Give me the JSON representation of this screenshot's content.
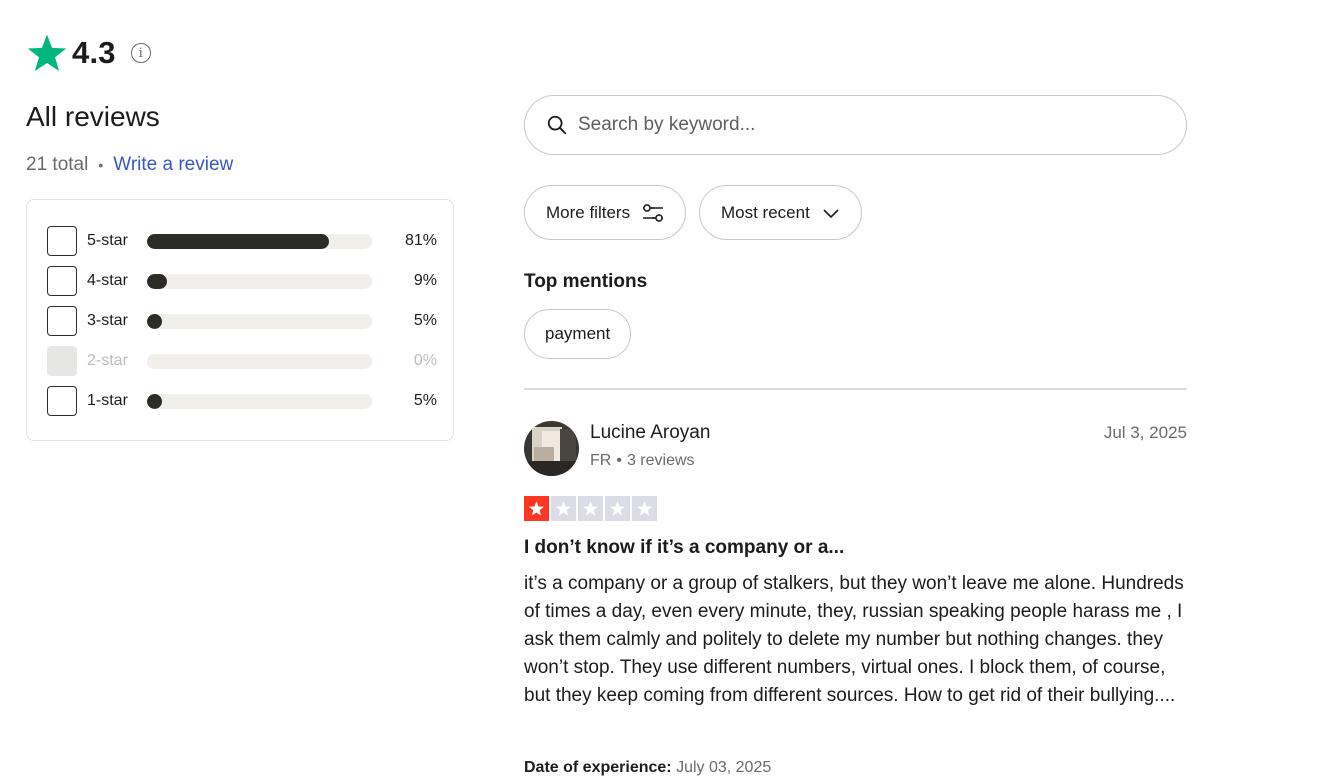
{
  "header": {
    "rating": "4.3",
    "info_icon": "ⓘ"
  },
  "reviews": {
    "title": "All reviews",
    "total": "21 total",
    "separator": "•",
    "write_review": "Write a review"
  },
  "distribution": [
    {
      "label": "5-star",
      "percent_text": "81%",
      "fraction": 0.81,
      "enabled": true
    },
    {
      "label": "4-star",
      "percent_text": "9%",
      "fraction": 0.09,
      "enabled": true
    },
    {
      "label": "3-star",
      "percent_text": "5%",
      "fraction": 0.05,
      "enabled": true
    },
    {
      "label": "2-star",
      "percent_text": "0%",
      "fraction": 0.0,
      "enabled": false
    },
    {
      "label": "1-star",
      "percent_text": "5%",
      "fraction": 0.05,
      "enabled": true
    }
  ],
  "search": {
    "placeholder": "Search by keyword..."
  },
  "filters": {
    "more_filters": "More filters",
    "sort": "Most recent"
  },
  "top_mentions": {
    "title": "Top mentions",
    "chips": [
      "payment"
    ]
  },
  "review": {
    "name": "Lucine Aroyan",
    "country": "FR",
    "meta_sep": "•",
    "count": "3 reviews",
    "date": "Jul 3, 2025",
    "stars": 1,
    "headline": "I don’t know if it’s a company or a...",
    "body": "it’s a company or a group of stalkers, but they won’t leave me alone. Hundreds of times a day, even every minute, they, russian speaking people harass me , I ask them calmly and politely to delete my number but nothing changes. they won’t stop. They use different numbers, virtual ones. I block them, of course, but they keep coming from different sources. How to get rid of their bullying....",
    "experience_label": "Date of experience:",
    "experience_date": "July 03, 2025"
  },
  "colors": {
    "brand_star": "#00b67a",
    "bad_star": "#ff3722",
    "empty_star": "#dcdce6",
    "link": "#3c57bc",
    "bar_fill": "#2b2b28",
    "bar_track": "#f1efe9"
  }
}
